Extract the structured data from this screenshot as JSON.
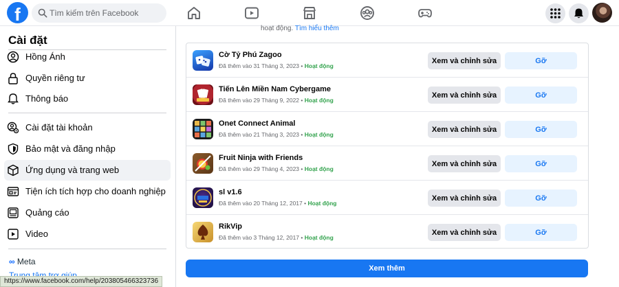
{
  "topbar": {
    "logo": "f",
    "search_placeholder": "Tìm kiếm trên Facebook",
    "nav_icons": [
      "home-icon",
      "video-icon",
      "marketplace-icon",
      "groups-icon",
      "gaming-icon"
    ],
    "right_icons": [
      "menu-grid-icon",
      "notifications-bell-icon"
    ]
  },
  "sidebar": {
    "title": "Cài đặt",
    "items": [
      {
        "label": "Hồng Ánh",
        "icon": "profile-icon"
      },
      {
        "label": "Quyền riêng tư",
        "icon": "lock-icon"
      },
      {
        "label": "Thông báo",
        "icon": "bell-icon"
      },
      {
        "label": "Cài đặt tài khoản",
        "icon": "account-settings-icon"
      },
      {
        "label": "Bảo mật và đăng nhập",
        "icon": "shield-icon"
      },
      {
        "label": "Ứng dụng và trang web",
        "icon": "cube-icon"
      },
      {
        "label": "Tiện ích tích hợp cho doanh nghiệp",
        "icon": "business-integrations-icon"
      },
      {
        "label": "Quảng cáo",
        "icon": "ads-icon"
      },
      {
        "label": "Video",
        "icon": "video-icon"
      }
    ],
    "meta_logo": "Meta",
    "help_link": "Trung tâm trợ giúp"
  },
  "main": {
    "note_text": "hoạt động.",
    "note_link": "Tìm hiểu thêm",
    "apps": [
      {
        "name": "Cờ Tỷ Phú Zagoo",
        "added": "Đã thêm vào 31 Tháng 3, 2023",
        "status": "Hoạt động"
      },
      {
        "name": "Tiến Lên Miền Nam Cybergame",
        "added": "Đã thêm vào 29 Tháng 9, 2022",
        "status": "Hoạt động"
      },
      {
        "name": "Onet Connect Animal",
        "added": "Đã thêm vào 21 Tháng 3, 2023",
        "status": "Hoạt động"
      },
      {
        "name": "Fruit Ninja with Friends",
        "added": "Đã thêm vào 29 Tháng 4, 2023",
        "status": "Hoạt động"
      },
      {
        "name": "sl v1.6",
        "added": "Đã thêm vào 20 Tháng 12, 2017",
        "status": "Hoạt động"
      },
      {
        "name": "RikVip",
        "added": "Đã thêm vào 3 Tháng 12, 2017",
        "status": "Hoạt động"
      }
    ],
    "edit_label": "Xem và chỉnh sửa",
    "remove_label": "Gỡ",
    "see_more_label": "Xem thêm"
  },
  "status_url": "https://www.facebook.com/help/203805466323736",
  "colors": {
    "accent": "#1877f2",
    "active_status": "#31a24c",
    "button_gray": "#e4e6eb",
    "button_blue_light": "#e7f3ff"
  }
}
